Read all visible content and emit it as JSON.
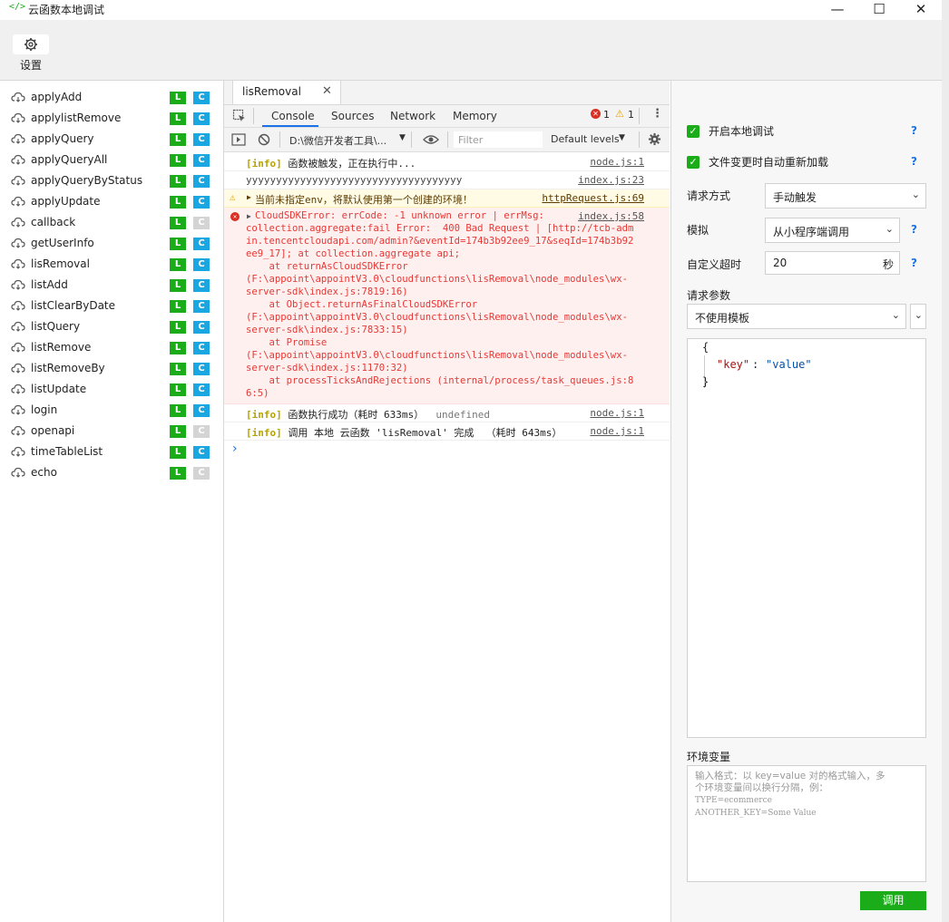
{
  "window": {
    "title": "云函数本地调试",
    "icon": "code-icon",
    "buttons": [
      "minimize",
      "maximize",
      "close"
    ]
  },
  "toolbar": {
    "settings_label": "设置",
    "settings_icon": "gear-icon"
  },
  "functions": [
    {
      "name": "applyAdd",
      "local": true,
      "cloud": true
    },
    {
      "name": "applylistRemove",
      "local": true,
      "cloud": true
    },
    {
      "name": "applyQuery",
      "local": true,
      "cloud": true
    },
    {
      "name": "applyQueryAll",
      "local": true,
      "cloud": true
    },
    {
      "name": "applyQueryByStatus",
      "local": true,
      "cloud": true
    },
    {
      "name": "applyUpdate",
      "local": true,
      "cloud": true
    },
    {
      "name": "callback",
      "local": true,
      "cloud": false
    },
    {
      "name": "getUserInfo",
      "local": true,
      "cloud": true
    },
    {
      "name": "lisRemoval",
      "local": true,
      "cloud": true
    },
    {
      "name": "listAdd",
      "local": true,
      "cloud": true
    },
    {
      "name": "listClearByDate",
      "local": true,
      "cloud": true
    },
    {
      "name": "listQuery",
      "local": true,
      "cloud": true
    },
    {
      "name": "listRemove",
      "local": true,
      "cloud": true
    },
    {
      "name": "listRemoveBy",
      "local": true,
      "cloud": true
    },
    {
      "name": "listUpdate",
      "local": true,
      "cloud": true
    },
    {
      "name": "login",
      "local": true,
      "cloud": true
    },
    {
      "name": "openapi",
      "local": true,
      "cloud": false
    },
    {
      "name": "timeTableList",
      "local": true,
      "cloud": true
    },
    {
      "name": "echo",
      "local": true,
      "cloud": false
    }
  ],
  "badges": {
    "local": "L",
    "cloud": "C"
  },
  "editor_tab": {
    "label": "lisRemoval",
    "close": "✕"
  },
  "devtools": {
    "tabs": [
      "Console",
      "Sources",
      "Network",
      "Memory"
    ],
    "active_tab": "Console",
    "error_count": "1",
    "warning_count": "1",
    "context": "D:\\微信开发者工具\\...",
    "filter_placeholder": "Filter",
    "levels": "Default levels"
  },
  "console": {
    "info_tag": "[info]",
    "lines": [
      {
        "type": "info",
        "text": "函数被触发，正在执行中...",
        "source": "node.js:1"
      },
      {
        "type": "log",
        "text": "yyyyyyyyyyyyyyyyyyyyyyyyyyyyyyyyyyyy",
        "source": "index.js:23"
      },
      {
        "type": "warn",
        "text": "当前未指定env，将默认使用第一个创建的环境！",
        "source": "httpRequest.js:69"
      },
      {
        "type": "error",
        "source": "index.js:58",
        "text_lines": [
          "CloudSDKError: errCode: -1 unknown error | errMsg:",
          "collection.aggregate:fail Error:  400 Bad Request | [http://tcb-adm",
          "in.tencentcloudapi.com/admin?&eventId=174b3b92ee9_17&seqId=174b3b92",
          "ee9_17]; at collection.aggregate api;",
          "    at returnAsCloudSDKError",
          "(F:\\appoint\\appointV3.0\\cloudfunctions\\lisRemoval\\node_modules\\wx-",
          "server-sdk\\index.js:7819:16)",
          "    at Object.returnAsFinalCloudSDKError",
          "(F:\\appoint\\appointV3.0\\cloudfunctions\\lisRemoval\\node_modules\\wx-",
          "server-sdk\\index.js:7833:15)",
          "    at Promise",
          "(F:\\appoint\\appointV3.0\\cloudfunctions\\lisRemoval\\node_modules\\wx-",
          "server-sdk\\index.js:1170:32)",
          "    at processTicksAndRejections (internal/process/task_queues.js:8",
          "6:5)"
        ]
      },
      {
        "type": "info",
        "text": "函数执行成功（耗时 633ms）",
        "extra": "undefined",
        "source": "node.js:1"
      },
      {
        "type": "info",
        "text": "调用 本地 云函数 'lisRemoval' 完成  （耗时 643ms）",
        "source": "node.js:1"
      }
    ],
    "prompt": "›"
  },
  "panel": {
    "enable_local": "开启本地调试",
    "auto_reload": "文件变更时自动重新加载",
    "help": "?",
    "request_method_label": "请求方式",
    "request_method_value": "手动触发",
    "simulate_label": "模拟",
    "simulate_value": "从小程序端调用",
    "timeout_label": "自定义超时",
    "timeout_value": "20",
    "timeout_unit": "秒",
    "params_label": "请求参数",
    "template_value": "不使用模板",
    "json_open": "{",
    "json_key": "\"key\"",
    "json_colon": ": ",
    "json_value": "\"value\"",
    "json_close": "}",
    "env_label": "环境变量",
    "env_placeholder_1": "输入格式：以 key=value 对的格式输入，多",
    "env_placeholder_2": "个环境变量间以换行分隔，例：",
    "env_placeholder_3": "TYPE=ecommerce",
    "env_placeholder_4": "ANOTHER_KEY=Some Value",
    "invoke_label": "调用"
  }
}
